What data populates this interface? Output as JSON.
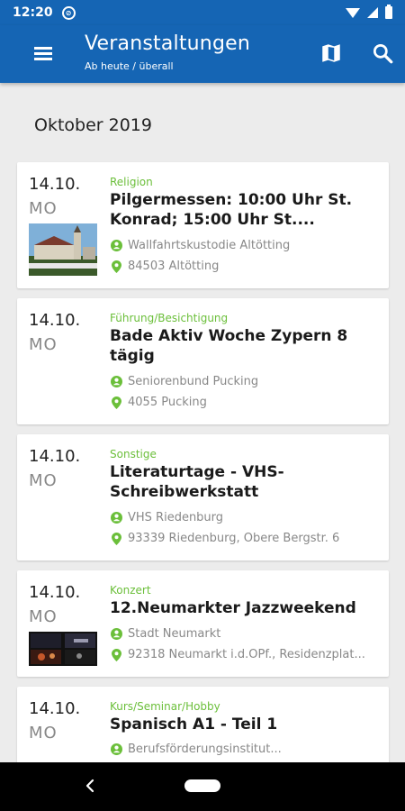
{
  "status": {
    "time": "12:20"
  },
  "appbar": {
    "title": "Veranstaltungen",
    "subtitle": "Ab heute / überall"
  },
  "month_header": "Oktober 2019",
  "events": [
    {
      "date": "14.10.",
      "weekday": "MO",
      "category": "Religion",
      "title": "Pilgermessen: 10:00 Uhr St. Konrad; 15:00 Uhr St....",
      "organizer": "Wallfahrtskustodie Altötting",
      "location": "84503 Altötting",
      "has_image": true
    },
    {
      "date": "14.10.",
      "weekday": "MO",
      "category": "Führung/Besichtigung",
      "title": "Bade Aktiv Woche Zypern 8 tägig",
      "organizer": "Seniorenbund Pucking",
      "location": "4055 Pucking",
      "has_image": false
    },
    {
      "date": "14.10.",
      "weekday": "MO",
      "category": "Sonstige",
      "title": "Literaturtage - VHS-Schreibwerkstatt",
      "organizer": "VHS Riedenburg",
      "location": "93339 Riedenburg, Obere Bergstr. 6",
      "has_image": false
    },
    {
      "date": "14.10.",
      "weekday": "MO",
      "category": "Konzert",
      "title": "12.Neumarkter Jazzweekend",
      "organizer": "Stadt Neumarkt",
      "location": "92318 Neumarkt i.d.OPf., Residenzplat...",
      "has_image": true
    },
    {
      "date": "14.10.",
      "weekday": "MO",
      "category": "Kurs/Seminar/Hobby",
      "title": "Spanisch A1 - Teil 1",
      "organizer": "Berufsförderungsinstitut...",
      "location": "",
      "has_image": false
    }
  ],
  "colors": {
    "primary": "#1565b4",
    "category_green": "#6bbf3a",
    "icon_green": "#6bbf3a"
  },
  "icons": {
    "menu": "hamburger-icon",
    "map": "map-icon",
    "search": "search-icon",
    "organizer": "person-icon",
    "location": "location-pin-icon"
  }
}
